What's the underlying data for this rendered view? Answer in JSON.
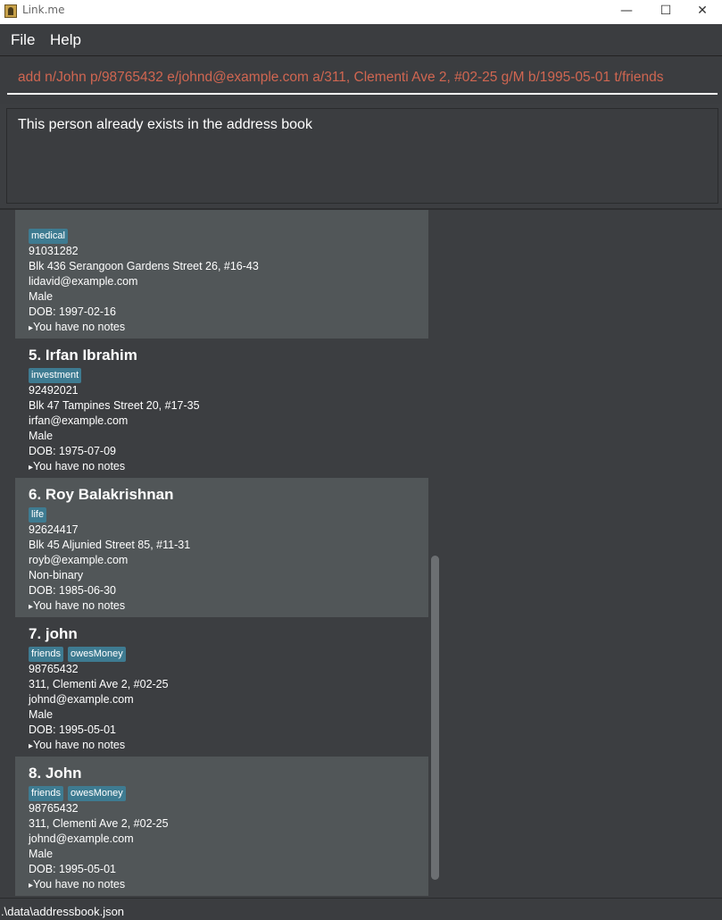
{
  "window": {
    "title": "Link.me",
    "minimize_glyph": "—",
    "maximize_glyph": "☐",
    "close_glyph": "✕"
  },
  "menu": {
    "file": "File",
    "help": "Help"
  },
  "command": {
    "value": "add n/John p/98765432 e/johnd@example.com a/311, Clementi Ave 2, #02-25 g/M b/1995-05-01 t/friends"
  },
  "result": {
    "message": "This person already exists in the address book"
  },
  "persons": [
    {
      "name": "",
      "tags": [
        "medical"
      ],
      "phone": "91031282",
      "address": "Blk 436 Serangoon Gardens Street 26, #16-43",
      "email": "lidavid@example.com",
      "gender": "Male",
      "dob": "DOB: 1997-02-16",
      "notes": "You have no notes"
    },
    {
      "name": "5.  Irfan Ibrahim",
      "tags": [
        "investment"
      ],
      "phone": "92492021",
      "address": "Blk 47 Tampines Street 20, #17-35",
      "email": "irfan@example.com",
      "gender": "Male",
      "dob": "DOB: 1975-07-09",
      "notes": "You have no notes"
    },
    {
      "name": "6.  Roy Balakrishnan",
      "tags": [
        "life"
      ],
      "phone": "92624417",
      "address": "Blk 45 Aljunied Street 85, #11-31",
      "email": "royb@example.com",
      "gender": "Non-binary",
      "dob": "DOB: 1985-06-30",
      "notes": "You have no notes"
    },
    {
      "name": "7.  john",
      "tags": [
        "friends",
        "owesMoney"
      ],
      "phone": "98765432",
      "address": "311, Clementi Ave 2, #02-25",
      "email": "johnd@example.com",
      "gender": "Male",
      "dob": "DOB: 1995-05-01",
      "notes": "You have no notes"
    },
    {
      "name": "8.  John",
      "tags": [
        "friends",
        "owesMoney"
      ],
      "phone": "98765432",
      "address": "311, Clementi Ave 2, #02-25",
      "email": "johnd@example.com",
      "gender": "Male",
      "dob": "DOB: 1995-05-01",
      "notes": "You have no notes"
    }
  ],
  "status": {
    "path": ".\\data\\addressbook.json"
  },
  "colors": {
    "accent_tag": "#3e7b91",
    "command_text": "#d06651",
    "card_light": "#515658",
    "card_dark": "#3c3e41"
  }
}
